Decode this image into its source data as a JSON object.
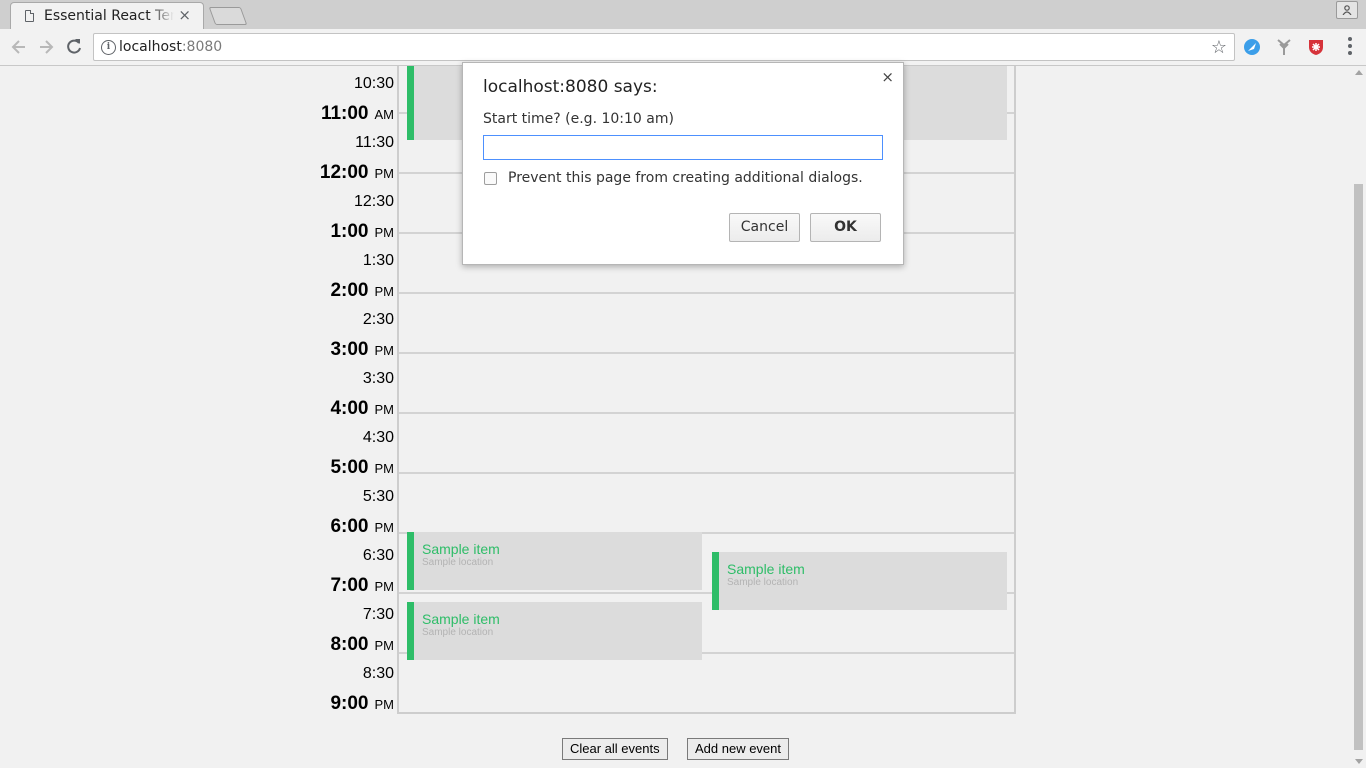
{
  "browser": {
    "tab_title": "Essential React Template",
    "tab_close": "×",
    "url_host": "localhost",
    "url_port": ":8080",
    "star": "☆"
  },
  "calendar": {
    "time_labels": [
      {
        "time": "10:30",
        "ampm": "",
        "half": true
      },
      {
        "time": "11:00",
        "ampm": "AM",
        "half": false
      },
      {
        "time": "11:30",
        "ampm": "",
        "half": true
      },
      {
        "time": "12:00",
        "ampm": "PM",
        "half": false
      },
      {
        "time": "12:30",
        "ampm": "",
        "half": true
      },
      {
        "time": "1:00",
        "ampm": "PM",
        "half": false
      },
      {
        "time": "1:30",
        "ampm": "",
        "half": true
      },
      {
        "time": "2:00",
        "ampm": "PM",
        "half": false
      },
      {
        "time": "2:30",
        "ampm": "",
        "half": true
      },
      {
        "time": "3:00",
        "ampm": "PM",
        "half": false
      },
      {
        "time": "3:30",
        "ampm": "",
        "half": true
      },
      {
        "time": "4:00",
        "ampm": "PM",
        "half": false
      },
      {
        "time": "4:30",
        "ampm": "",
        "half": true
      },
      {
        "time": "5:00",
        "ampm": "PM",
        "half": false
      },
      {
        "time": "5:30",
        "ampm": "",
        "half": true
      },
      {
        "time": "6:00",
        "ampm": "PM",
        "half": false
      },
      {
        "time": "6:30",
        "ampm": "",
        "half": true
      },
      {
        "time": "7:00",
        "ampm": "PM",
        "half": false
      },
      {
        "time": "7:30",
        "ampm": "",
        "half": true
      },
      {
        "time": "8:00",
        "ampm": "PM",
        "half": false
      },
      {
        "time": "8:30",
        "ampm": "",
        "half": true
      },
      {
        "time": "9:00",
        "ampm": "PM",
        "half": false
      }
    ],
    "events": [
      {
        "title": "",
        "location": ""
      },
      {
        "title": "Sample item",
        "location": "Sample location"
      },
      {
        "title": "Sample item",
        "location": "Sample location"
      },
      {
        "title": "Sample item",
        "location": "Sample location"
      }
    ],
    "clear_button": "Clear all events",
    "add_button": "Add new event"
  },
  "dialog": {
    "title": "localhost:8080 says:",
    "message": "Start time? (e.g. 10:10 am)",
    "input_value": "",
    "checkbox_label": "Prevent this page from creating additional dialogs.",
    "cancel_label": "Cancel",
    "ok_label": "OK",
    "close": "×"
  },
  "colors": {
    "event_accent": "#2ebd68",
    "event_bg": "#dcdcdc",
    "page_bg": "#f1f1f1"
  }
}
